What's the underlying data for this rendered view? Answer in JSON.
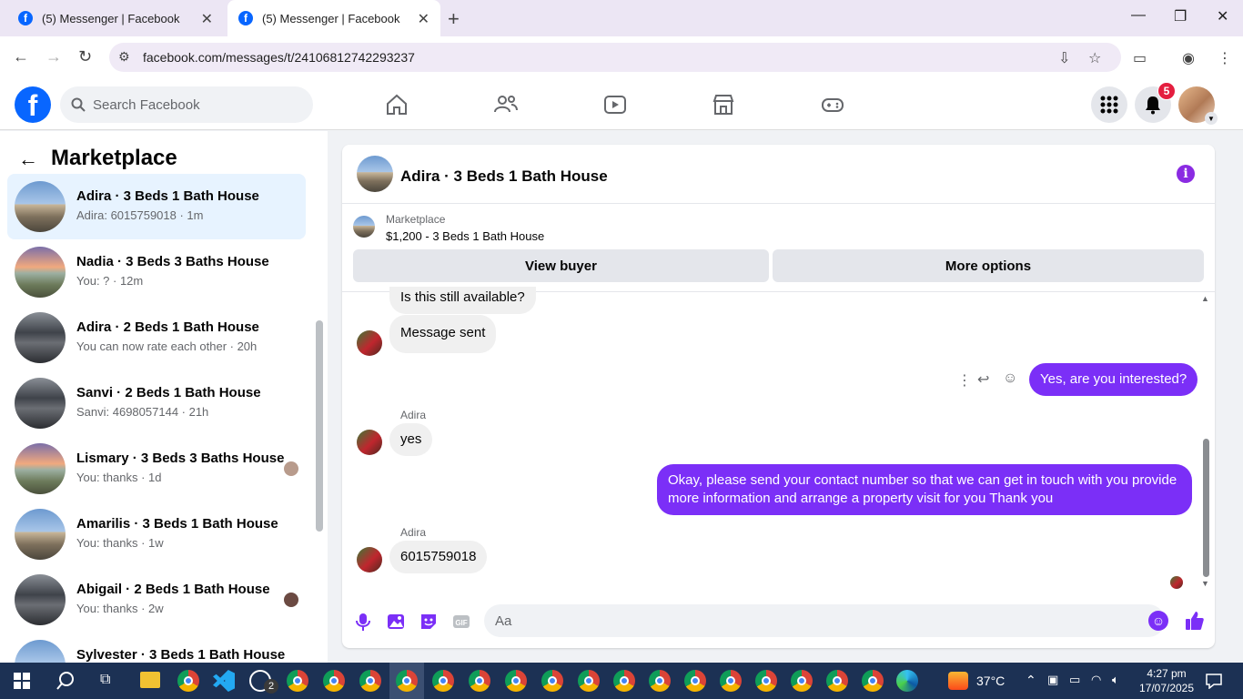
{
  "browser": {
    "tabs": [
      {
        "title": "(5) Messenger | Facebook"
      },
      {
        "title": "(5) Messenger | Facebook"
      }
    ],
    "url": "facebook.com/messages/t/24106812742293237"
  },
  "fb_header": {
    "search_placeholder": "Search Facebook",
    "notification_count": "5"
  },
  "sidebar": {
    "title": "Marketplace",
    "conversations": [
      {
        "name": "Adira · 3 Beds 1 Bath House",
        "preview": "Adira: 6015759018 · 1m"
      },
      {
        "name": "Nadia · 3 Beds 3 Baths House",
        "preview": "You: ? · 12m"
      },
      {
        "name": "Adira · 2 Beds 1 Bath House",
        "preview": "You can now rate each other · 20h"
      },
      {
        "name": "Sanvi · 2 Beds 1 Bath House",
        "preview": "Sanvi: 4698057144 · 21h"
      },
      {
        "name": "Lismary · 3 Beds 3 Baths House",
        "preview": "You: thanks · 1d"
      },
      {
        "name": "Amarilis · 3 Beds 1 Bath House",
        "preview": "You: thanks · 1w"
      },
      {
        "name": "Abigail · 2 Beds 1 Bath House",
        "preview": "You: thanks · 2w"
      },
      {
        "name": "Sylvester · 3 Beds 1 Bath House",
        "preview": ""
      }
    ]
  },
  "chat": {
    "title": "Adira · 3 Beds 1 Bath House",
    "marketplace_label": "Marketplace",
    "listing": "$1,200 - 3 Beds 1 Bath House",
    "view_buyer": "View buyer",
    "more_options": "More options",
    "messages": [
      {
        "from": "them",
        "text": "Is this still available?"
      },
      {
        "from": "them",
        "text": "Message sent"
      },
      {
        "from": "me",
        "text": "Yes, are you interested?"
      },
      {
        "from": "them",
        "sender": "Adira",
        "text": "yes"
      },
      {
        "from": "me",
        "text": "Okay, please send your contact number so that we can get in touch with you provide more information and arrange a property visit for you Thank you"
      },
      {
        "from": "them",
        "sender": "Adira",
        "text": "6015759018"
      }
    ],
    "composer_placeholder": "Aa"
  },
  "taskbar": {
    "temperature": "37°C",
    "time": "4:27 pm",
    "date": "17/07/2025",
    "whatsapp_badge": "2"
  },
  "colors": {
    "messenger_purple": "#7b2ff7",
    "facebook_blue": "#0866ff"
  }
}
